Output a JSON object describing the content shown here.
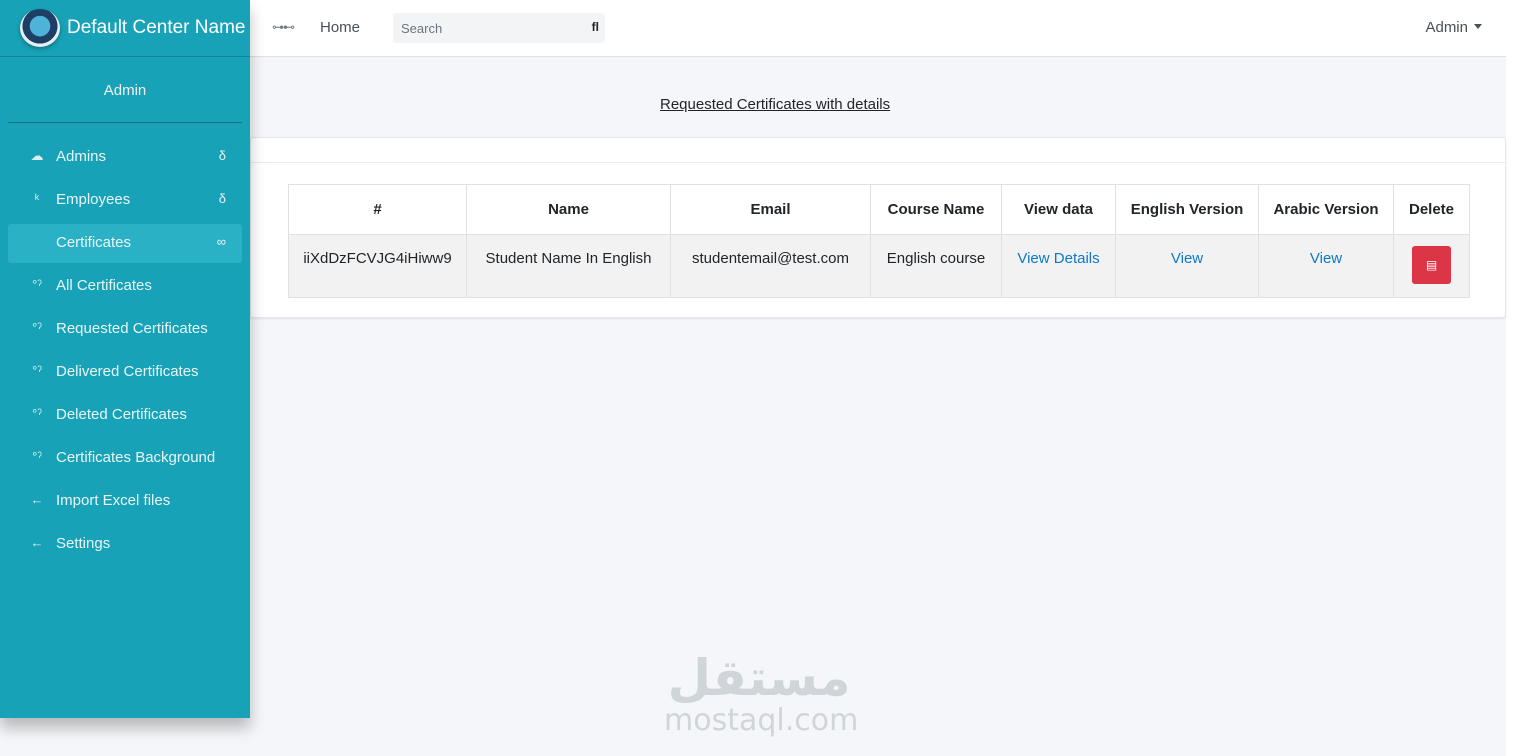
{
  "brand": {
    "name": "Default Center Name"
  },
  "navbar": {
    "toggle_icon": "sliders-icon",
    "home_label": "Home",
    "search_placeholder": "Search",
    "search_icon": "search-icon",
    "user_label": "Admin"
  },
  "sidebar": {
    "user_name": "Admin",
    "items": [
      {
        "label": "Admins",
        "icon": "users-icon",
        "right": "δ",
        "active": false
      },
      {
        "label": "Employees",
        "icon": "employee-icon",
        "right": "δ",
        "active": false
      },
      {
        "label": "Certificates",
        "icon": "",
        "right": "∞",
        "active": true
      },
      {
        "label": "All Certificates",
        "icon": "circle-icon",
        "right": "",
        "active": false
      },
      {
        "label": "Requested Certificates",
        "icon": "circle-icon",
        "right": "",
        "active": false
      },
      {
        "label": "Delivered Certificates",
        "icon": "circle-icon",
        "right": "",
        "active": false
      },
      {
        "label": "Deleted Certificates",
        "icon": "circle-icon",
        "right": "",
        "active": false
      },
      {
        "label": "Certificates Background",
        "icon": "circle-icon",
        "right": "",
        "active": false
      },
      {
        "label": "Import Excel files",
        "icon": "arrow-left-icon",
        "right": "",
        "active": false
      },
      {
        "label": "Settings",
        "icon": "arrow-left-icon",
        "right": "",
        "active": false
      }
    ]
  },
  "main": {
    "title": "Requested Certificates with details",
    "table": {
      "headers": [
        "#",
        "Name",
        "Email",
        "Course Name",
        "View data",
        "English Version",
        "Arabic Version",
        "Delete"
      ],
      "rows": [
        {
          "id": "iiXdDzFCVJG4iHiww9",
          "name": "Student Name In English",
          "email": "studentemail@test.com",
          "course": "English course",
          "view_data": "View Details",
          "english": "View",
          "arabic": "View",
          "delete_icon": "trash-icon"
        }
      ]
    }
  },
  "watermark": {
    "arabic": "مستقل",
    "latin": "mostaql.com"
  },
  "colors": {
    "sidebar": "#17a2b8",
    "active_item": "#2bb1c5",
    "delete": "#dc3545",
    "link": "#0d78c9"
  }
}
